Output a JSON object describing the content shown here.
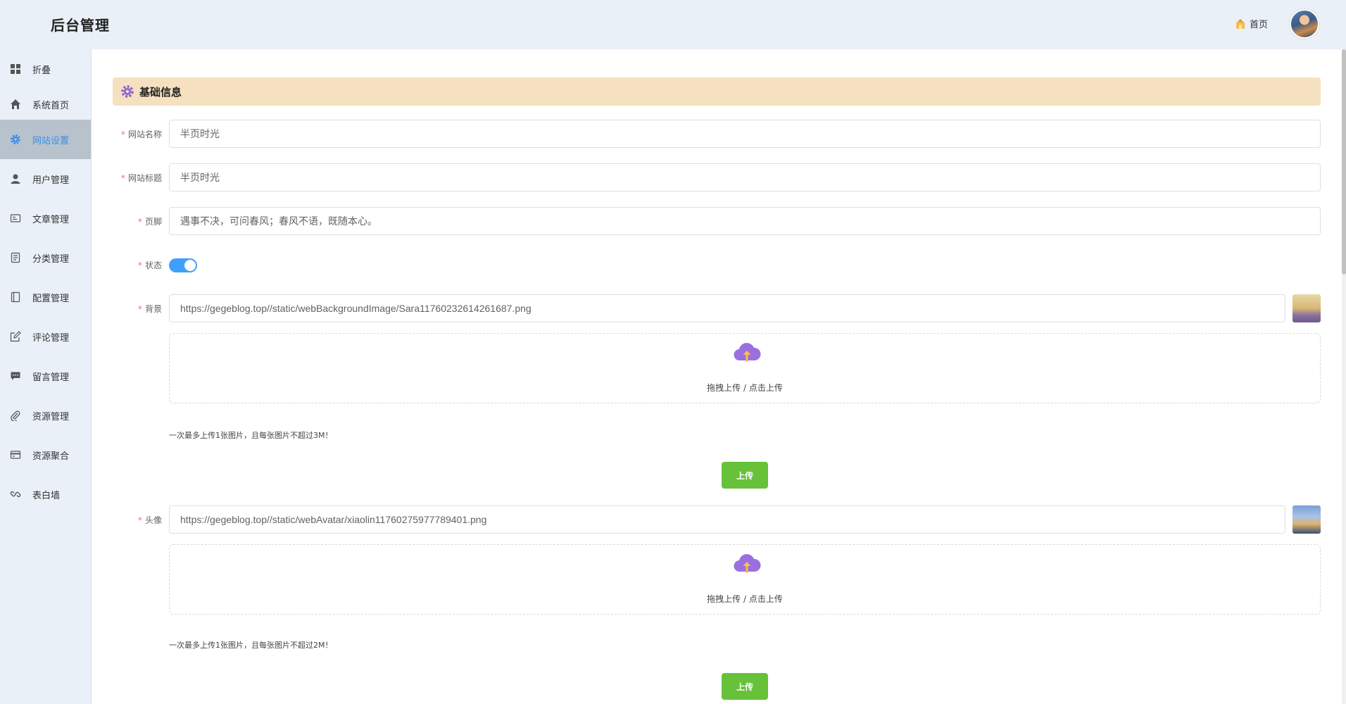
{
  "app": {
    "title": "后台管理"
  },
  "header": {
    "home_label": "首页"
  },
  "sidebar": {
    "items": [
      {
        "label": "折叠",
        "icon": "grid-icon"
      },
      {
        "label": "系统首页",
        "icon": "home-icon"
      },
      {
        "label": "网站设置",
        "icon": "gear-icon",
        "active": true
      },
      {
        "label": "用户管理",
        "icon": "user-icon"
      },
      {
        "label": "文章管理",
        "icon": "article-icon"
      },
      {
        "label": "分类管理",
        "icon": "document-icon"
      },
      {
        "label": "配置管理",
        "icon": "notebook-icon"
      },
      {
        "label": "评论管理",
        "icon": "edit-icon"
      },
      {
        "label": "留言管理",
        "icon": "chat-icon"
      },
      {
        "label": "资源管理",
        "icon": "paperclip-icon"
      },
      {
        "label": "资源聚合",
        "icon": "card-icon"
      },
      {
        "label": "表白墙",
        "icon": "link-icon"
      }
    ]
  },
  "section": {
    "title": "基础信息"
  },
  "form": {
    "site_name": {
      "label": "网站名称",
      "value": "半页时光"
    },
    "site_title": {
      "label": "网站标题",
      "value": "半页时光"
    },
    "footer": {
      "label": "页脚",
      "value": "遇事不决，可问春风；春风不语，既随本心。"
    },
    "status": {
      "label": "状态",
      "enabled": true
    },
    "background": {
      "label": "背景",
      "value": "https://gegeblog.top//static/webBackgroundImage/Sara11760232614261687.png",
      "upload_text": "拖拽上传 / 点击上传",
      "hint": "一次最多上传1张图片，且每张图片不超过3M！",
      "button": "上传"
    },
    "avatar": {
      "label": "头像",
      "value": "https://gegeblog.top//static/webAvatar/xiaolin11760275977789401.png",
      "upload_text": "拖拽上传 / 点击上传",
      "hint": "一次最多上传1张图片，且每张图片不超过2M！",
      "button": "上传"
    }
  },
  "colors": {
    "accent": "#409eff",
    "success": "#67c23a",
    "header_bg": "#f5e1bf",
    "upload_icon": "#9b6fe0"
  }
}
